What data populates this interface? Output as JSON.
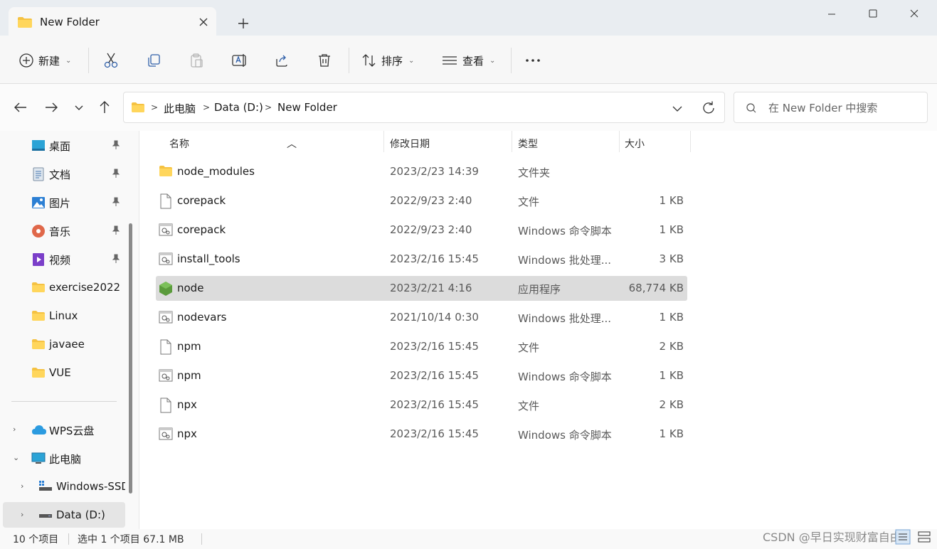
{
  "window": {
    "tab_title": "New Folder",
    "icons": {
      "folder": "folder-icon",
      "close_tab": "close-icon",
      "new_tab": "plus-icon",
      "minimize": "minimize-icon",
      "maximize": "maximize-icon",
      "close": "close-icon"
    }
  },
  "toolbar": {
    "new_label": "新建",
    "sort_label": "排序",
    "view_label": "查看",
    "icons": [
      "plus-circle-icon",
      "cut-icon",
      "copy-icon",
      "paste-icon",
      "rename-icon",
      "share-icon",
      "delete-icon",
      "sort-icon",
      "view-icon",
      "more-icon"
    ]
  },
  "address": {
    "breadcrumbs": [
      "此电脑",
      "Data (D:)",
      "New Folder"
    ],
    "separator": ">",
    "search_placeholder": "在 New Folder 中搜索"
  },
  "nav": {
    "quick_access": [
      {
        "label": "桌面",
        "icon": "desktop-icon",
        "pinned": true
      },
      {
        "label": "文档",
        "icon": "documents-icon",
        "pinned": true
      },
      {
        "label": "图片",
        "icon": "pictures-icon",
        "pinned": true
      },
      {
        "label": "音乐",
        "icon": "music-icon",
        "pinned": true
      },
      {
        "label": "视频",
        "icon": "videos-icon",
        "pinned": true
      },
      {
        "label": "exercise2022",
        "icon": "folder-icon",
        "pinned": false
      },
      {
        "label": "Linux",
        "icon": "folder-icon",
        "pinned": false
      },
      {
        "label": "javaee",
        "icon": "folder-icon",
        "pinned": false
      },
      {
        "label": "VUE",
        "icon": "folder-icon",
        "pinned": false
      }
    ],
    "tree": [
      {
        "label": "WPS云盘",
        "icon": "cloud-icon",
        "expander": "›"
      },
      {
        "label": "此电脑",
        "icon": "computer-icon",
        "expander": "⌄"
      },
      {
        "label": "Windows-SSD",
        "icon": "drive-icon",
        "expander": "›"
      },
      {
        "label": "Data (D:)",
        "icon": "drive-icon",
        "expander": "›"
      }
    ]
  },
  "columns": {
    "name": "名称",
    "date": "修改日期",
    "type": "类型",
    "size": "大小"
  },
  "files": [
    {
      "name": "node_modules",
      "date": "2023/2/23 14:39",
      "type": "文件夹",
      "size": "",
      "icon": "folder-icon"
    },
    {
      "name": "corepack",
      "date": "2022/9/23 2:40",
      "type": "文件",
      "size": "1 KB",
      "icon": "file-icon"
    },
    {
      "name": "corepack",
      "date": "2022/9/23 2:40",
      "type": "Windows 命令脚本",
      "size": "1 KB",
      "icon": "script-icon"
    },
    {
      "name": "install_tools",
      "date": "2023/2/16 15:45",
      "type": "Windows 批处理...",
      "size": "3 KB",
      "icon": "script-icon"
    },
    {
      "name": "node",
      "date": "2023/2/21 4:16",
      "type": "应用程序",
      "size": "68,774 KB",
      "icon": "node-icon",
      "selected": true
    },
    {
      "name": "nodevars",
      "date": "2021/10/14 0:30",
      "type": "Windows 批处理...",
      "size": "1 KB",
      "icon": "script-icon"
    },
    {
      "name": "npm",
      "date": "2023/2/16 15:45",
      "type": "文件",
      "size": "2 KB",
      "icon": "file-icon"
    },
    {
      "name": "npm",
      "date": "2023/2/16 15:45",
      "type": "Windows 命令脚本",
      "size": "1 KB",
      "icon": "script-icon"
    },
    {
      "name": "npx",
      "date": "2023/2/16 15:45",
      "type": "文件",
      "size": "2 KB",
      "icon": "file-icon"
    },
    {
      "name": "npx",
      "date": "2023/2/16 15:45",
      "type": "Windows 命令脚本",
      "size": "1 KB",
      "icon": "script-icon"
    }
  ],
  "status": {
    "count": "10 个项目",
    "selection": "选中 1 个项目 67.1 MB"
  },
  "watermark": "CSDN @早日实现财富自由",
  "colors": {
    "folder": "#f5c242",
    "node_green": "#5b9b3c",
    "selection": "#dcdcdc",
    "accent": "#0067c0"
  }
}
